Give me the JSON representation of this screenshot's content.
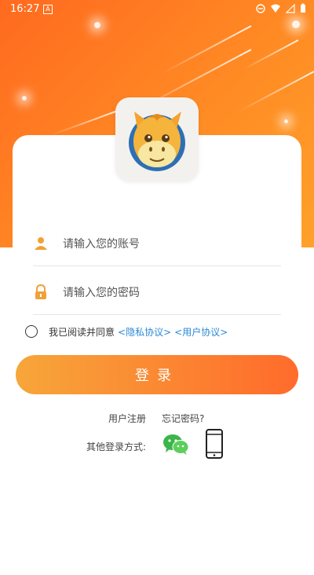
{
  "status_bar": {
    "time": "16:27",
    "notification_icon": "A",
    "battery_icon": "battery-icon"
  },
  "login": {
    "account_placeholder": "请输入您的账号",
    "password_placeholder": "请输入您的密码",
    "agree_text": "我已阅读并同意",
    "privacy_link": "<隐私协议>",
    "user_agreement_link": "<用户协议>",
    "login_button": "登录",
    "register_link": "用户注册",
    "forgot_link": "忘记密码?",
    "other_login_label": "其他登录方式:"
  },
  "colors": {
    "brand_orange": "#ff6b2b",
    "link_blue": "#2a8ad8",
    "wechat_green": "#3ab54a"
  }
}
